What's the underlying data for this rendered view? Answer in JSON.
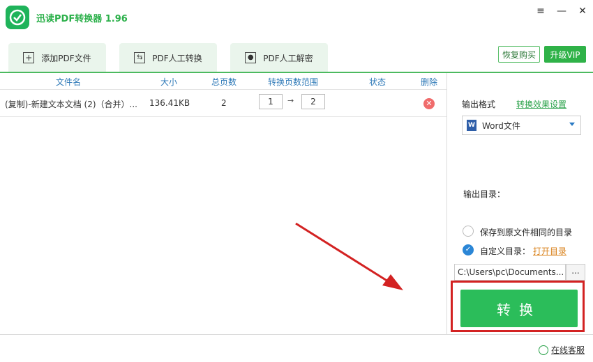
{
  "app": {
    "title": "迅读PDF转换器 1.96"
  },
  "window_controls": {
    "menu": "≡",
    "minimize": "—",
    "close": "✕"
  },
  "toolbar": {
    "tabs": [
      {
        "label": "添加PDF文件",
        "icon": "plus-icon"
      },
      {
        "label": "PDF人工转换",
        "icon": "convert-icon"
      },
      {
        "label": "PDF人工解密",
        "icon": "portrait-icon"
      }
    ],
    "restore_purchase": "恢复购买",
    "upgrade_vip": "升级VIP"
  },
  "table": {
    "headers": [
      "文件名",
      "大小",
      "总页数",
      "转换页数范围",
      "状态",
      "删除"
    ],
    "rows": [
      {
        "name": "(复制)-新建文本文档 (2)（合并）...",
        "size": "136.41KB",
        "pages": "2",
        "range_from": "1",
        "range_to": "2",
        "status": ""
      }
    ]
  },
  "panel": {
    "output_format_label": "输出格式",
    "effect_settings_link": "转换效果设置",
    "format_selected": "Word文件",
    "output_dir_label": "输出目录：",
    "option_same_dir": "保存到原文件相同的目录",
    "option_custom_dir": "自定义目录：",
    "open_dir_link": "打开目录",
    "path_value": "C:\\Users\\pc\\Documents...",
    "browse_label": "...",
    "convert_label": "转换",
    "same_dir_checked": false,
    "custom_dir_checked": true
  },
  "footer": {
    "online_service": "在线客服"
  },
  "colors": {
    "accent": "#2bbd5a",
    "header_text": "#2f7ab8",
    "highlight": "#d32222"
  }
}
